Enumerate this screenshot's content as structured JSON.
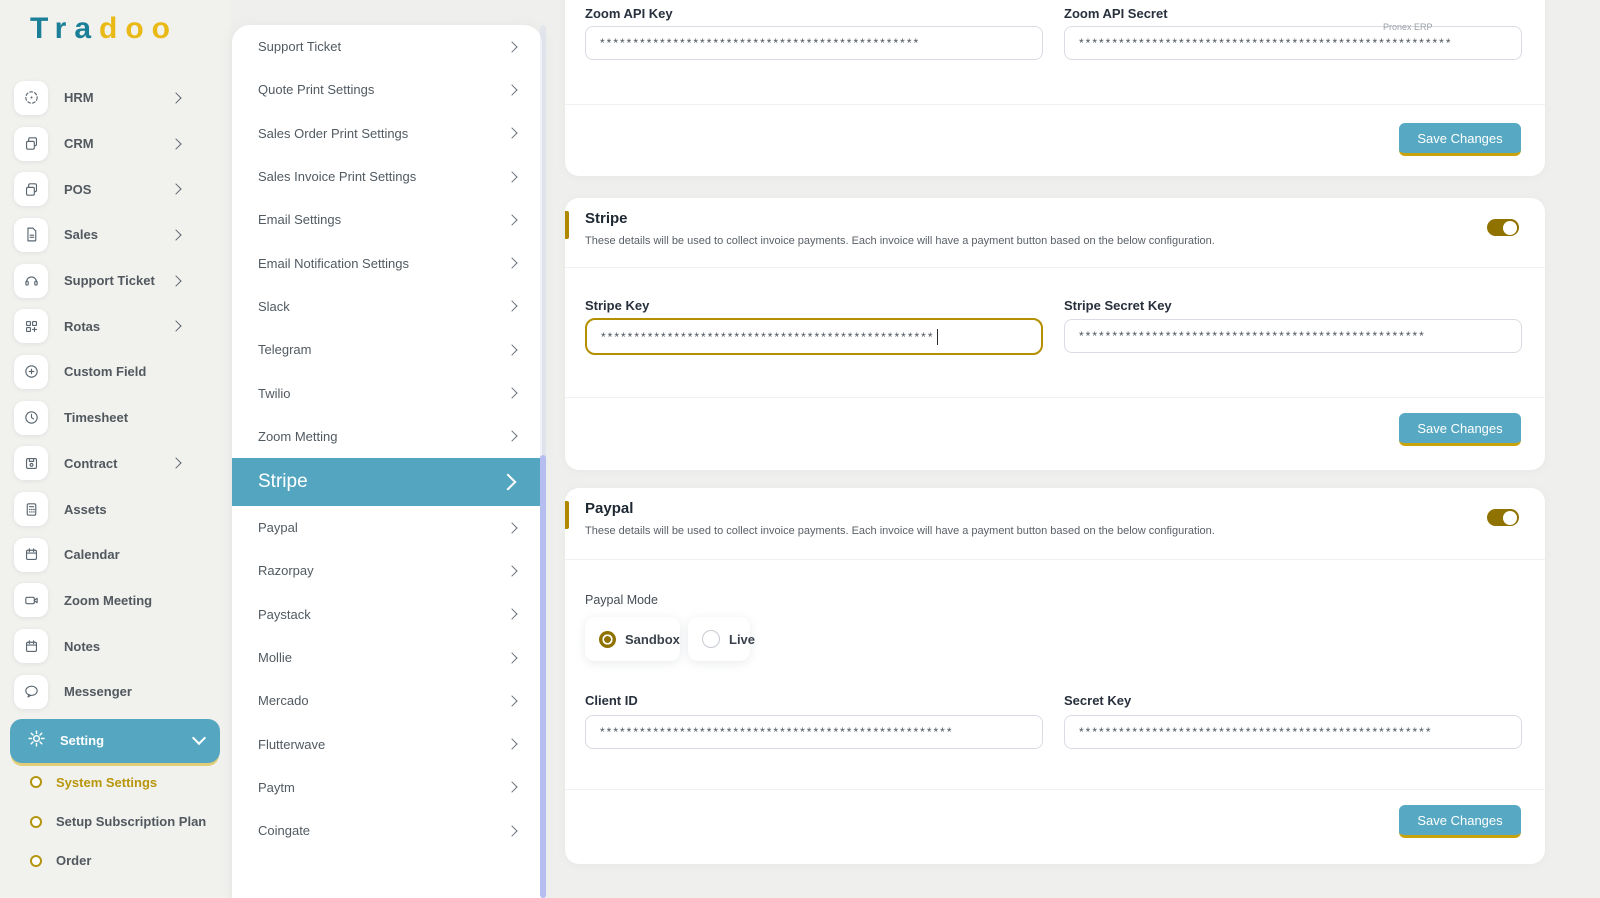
{
  "brand": {
    "name_part1": "Tra",
    "name_part2": "doo"
  },
  "sidebar": {
    "items": [
      {
        "label": "HRM",
        "icon": "hrm-icon",
        "has_submenu": true
      },
      {
        "label": "CRM",
        "icon": "crm-icon",
        "has_submenu": true
      },
      {
        "label": "POS",
        "icon": "pos-icon",
        "has_submenu": true
      },
      {
        "label": "Sales",
        "icon": "sales-icon",
        "has_submenu": true
      },
      {
        "label": "Support Ticket",
        "icon": "support-ticket-icon",
        "has_submenu": true
      },
      {
        "label": "Rotas",
        "icon": "rotas-icon",
        "has_submenu": true
      },
      {
        "label": "Custom Field",
        "icon": "custom-field-icon",
        "has_submenu": false
      },
      {
        "label": "Timesheet",
        "icon": "timesheet-icon",
        "has_submenu": false
      },
      {
        "label": "Contract",
        "icon": "contract-icon",
        "has_submenu": true
      },
      {
        "label": "Assets",
        "icon": "assets-icon",
        "has_submenu": false
      },
      {
        "label": "Calendar",
        "icon": "calendar-icon",
        "has_submenu": false
      },
      {
        "label": "Zoom Meeting",
        "icon": "video-camera-icon",
        "has_submenu": false
      },
      {
        "label": "Notes",
        "icon": "notes-icon",
        "has_submenu": false
      },
      {
        "label": "Messenger",
        "icon": "chat-bubble-icon",
        "has_submenu": false
      }
    ],
    "setting": {
      "label": "Setting",
      "icon": "gear-icon",
      "expanded": true
    },
    "setting_subitems": [
      {
        "label": "System Settings",
        "active": true
      },
      {
        "label": "Setup Subscription Plan",
        "active": false
      },
      {
        "label": "Order",
        "active": false
      }
    ]
  },
  "settings_menu": {
    "items": [
      "Support Ticket",
      "Quote Print Settings",
      "Sales Order Print Settings",
      "Sales Invoice Print Settings",
      "Email Settings",
      "Email Notification Settings",
      "Slack",
      "Telegram",
      "Twilio",
      "Zoom Metting",
      "Stripe",
      "Paypal",
      "Razorpay",
      "Paystack",
      "Mollie",
      "Mercado",
      "Flutterwave",
      "Paytm",
      "Coingate"
    ],
    "selected": "Stripe"
  },
  "watermark": "Pronex ERP",
  "sections": {
    "zoom": {
      "fields": [
        {
          "label": "Zoom API Key",
          "value": "************************************************"
        },
        {
          "label": "Zoom API Secret",
          "value": "********************************************************"
        }
      ],
      "save_label": "Save Changes"
    },
    "stripe": {
      "title": "Stripe",
      "description": "These details will be used to collect invoice payments. Each invoice will have a payment button based on the below configuration.",
      "enabled": true,
      "fields": [
        {
          "label": "Stripe Key",
          "value": "**************************************************",
          "focused": true
        },
        {
          "label": "Stripe Secret Key",
          "value": "****************************************************"
        }
      ],
      "save_label": "Save Changes"
    },
    "paypal": {
      "title": "Paypal",
      "description": "These details will be used to collect invoice payments. Each invoice will have a payment button based on the below configuration.",
      "enabled": true,
      "mode_label": "Paypal Mode",
      "modes": [
        {
          "label": "Sandbox",
          "selected": true
        },
        {
          "label": "Live",
          "selected": false
        }
      ],
      "fields": [
        {
          "label": "Client ID",
          "value": "*****************************************************"
        },
        {
          "label": "Secret Key",
          "value": "*****************************************************"
        }
      ],
      "save_label": "Save Changes"
    }
  },
  "colors": {
    "accent_teal": "#55a7c1",
    "accent_gold": "#8f7200",
    "logo_teal": "#1b7f98",
    "logo_yellow": "#e9ba16",
    "selected_menu_bg": "#54a6c0",
    "save_button_bg": "#57a9c3",
    "save_button_underline": "#c9a30b"
  }
}
